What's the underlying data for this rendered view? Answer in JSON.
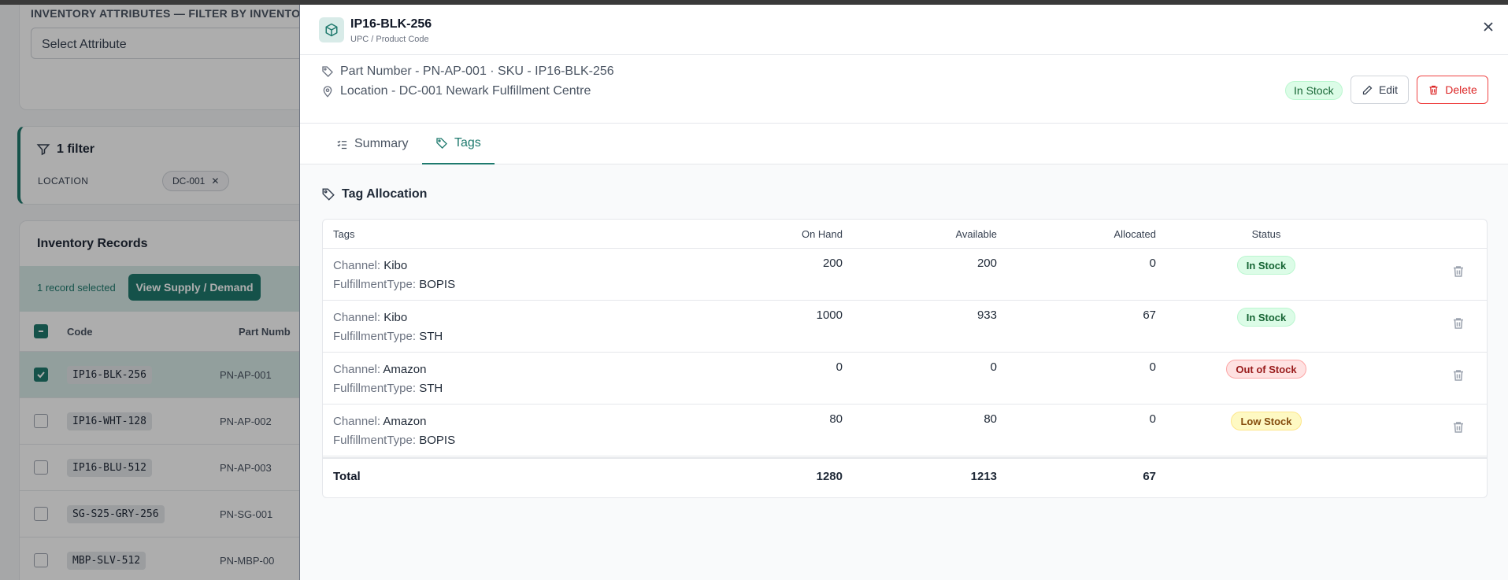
{
  "background": {
    "attributes": {
      "title": "INVENTORY ATTRIBUTES — FILTER BY INVENTORY",
      "select_placeholder": "Select Attribute"
    },
    "filters": {
      "title": "1 filter",
      "label": "LOCATION",
      "chip": "DC-001"
    },
    "records": {
      "title": "Inventory Records",
      "selected_text": "1 record selected",
      "action_button": "View Supply / Demand",
      "columns": [
        "Code",
        "Part Numb"
      ],
      "rows": [
        {
          "code": "IP16-BLK-256",
          "part": "PN-AP-001",
          "checked": true
        },
        {
          "code": "IP16-WHT-128",
          "part": "PN-AP-002",
          "checked": false
        },
        {
          "code": "IP16-BLU-512",
          "part": "PN-AP-003",
          "checked": false
        },
        {
          "code": "SG-S25-GRY-256",
          "part": "PN-SG-001",
          "checked": false
        },
        {
          "code": "MBP-SLV-512",
          "part": "PN-MBP-00",
          "checked": false
        }
      ]
    }
  },
  "drawer": {
    "title": "IP16-BLK-256",
    "subtitle": "UPC / Product Code",
    "info_line1": "Part Number - PN-AP-001 · SKU - IP16-BLK-256",
    "info_line2": "Location - DC-001 Newark Fulfillment Centre",
    "status_badge": "In Stock",
    "edit_label": "Edit",
    "delete_label": "Delete",
    "tabs": [
      {
        "label": "Summary",
        "active": false
      },
      {
        "label": "Tags",
        "active": true
      }
    ],
    "section_title": "Tag Allocation",
    "table": {
      "columns": {
        "tags": "Tags",
        "on_hand": "On Hand",
        "available": "Available",
        "allocated": "Allocated",
        "status": "Status"
      },
      "rows": [
        {
          "channel_key": "Channel:",
          "channel": "Kibo",
          "ft_key": "FulfillmentType:",
          "ft": "BOPIS",
          "on_hand": "200",
          "available": "200",
          "allocated": "0",
          "status": "In Stock",
          "status_kind": "green"
        },
        {
          "channel_key": "Channel:",
          "channel": "Kibo",
          "ft_key": "FulfillmentType:",
          "ft": "STH",
          "on_hand": "1000",
          "available": "933",
          "allocated": "67",
          "status": "In Stock",
          "status_kind": "green"
        },
        {
          "channel_key": "Channel:",
          "channel": "Amazon",
          "ft_key": "FulfillmentType:",
          "ft": "STH",
          "on_hand": "0",
          "available": "0",
          "allocated": "0",
          "status": "Out of Stock",
          "status_kind": "red"
        },
        {
          "channel_key": "Channel:",
          "channel": "Amazon",
          "ft_key": "FulfillmentType:",
          "ft": "BOPIS",
          "on_hand": "80",
          "available": "80",
          "allocated": "0",
          "status": "Low Stock",
          "status_kind": "yellow"
        }
      ],
      "total": {
        "label": "Total",
        "on_hand": "1280",
        "available": "1213",
        "allocated": "67"
      }
    }
  },
  "colors": {
    "accent": "#1f7a6e",
    "danger": "#dc2626"
  }
}
